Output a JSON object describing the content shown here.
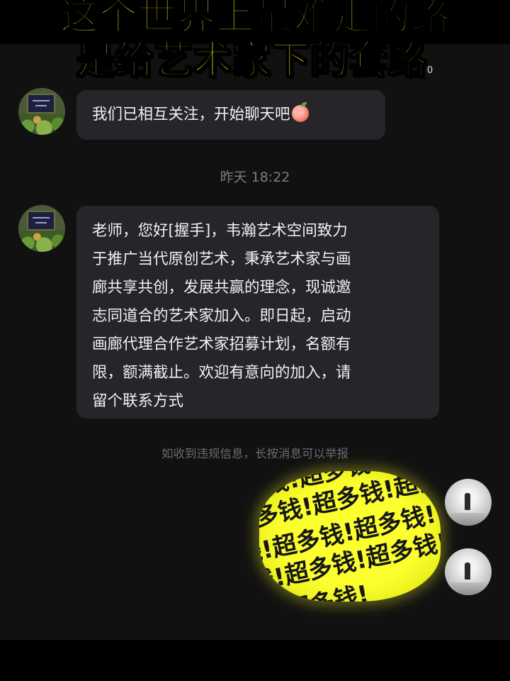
{
  "caption": {
    "line1": "这个世界上最难走的路",
    "line2": "是给艺术家下的套路",
    "stray_mark": "0"
  },
  "chat": {
    "greeting_message": "我们已相互关注，开始聊天吧",
    "greeting_emoji": "peach-icon",
    "timestamp": "昨天 18:22",
    "message_lines": [
      "老师，您好[握手]，韦瀚艺术空间致力",
      "于推广当代原创艺术，秉承艺术家与画",
      "廊共享共创，发展共赢的理念，现诚邀",
      "志同道合的艺术家加入。即日起，启动",
      "画廊代理合作艺术家招募计划，名额有",
      "限，额满截止。欢迎有意向的加入，请",
      "留个联系方式"
    ],
    "report_notice": "如收到违规信息，长按消息可以举报"
  },
  "sticker": {
    "rows": [
      "多钱!超多钱!超多",
      "超多钱!超多钱!超多钱",
      "钱!超多钱!超多钱!",
      "多钱!超多钱!超多钱!",
      "钱!超多钱!"
    ]
  },
  "colors": {
    "background": "#111111",
    "bubble": "#25252a",
    "caption_yellow": "#f7ef1a",
    "sticker_yellow": "#fbff2e"
  }
}
